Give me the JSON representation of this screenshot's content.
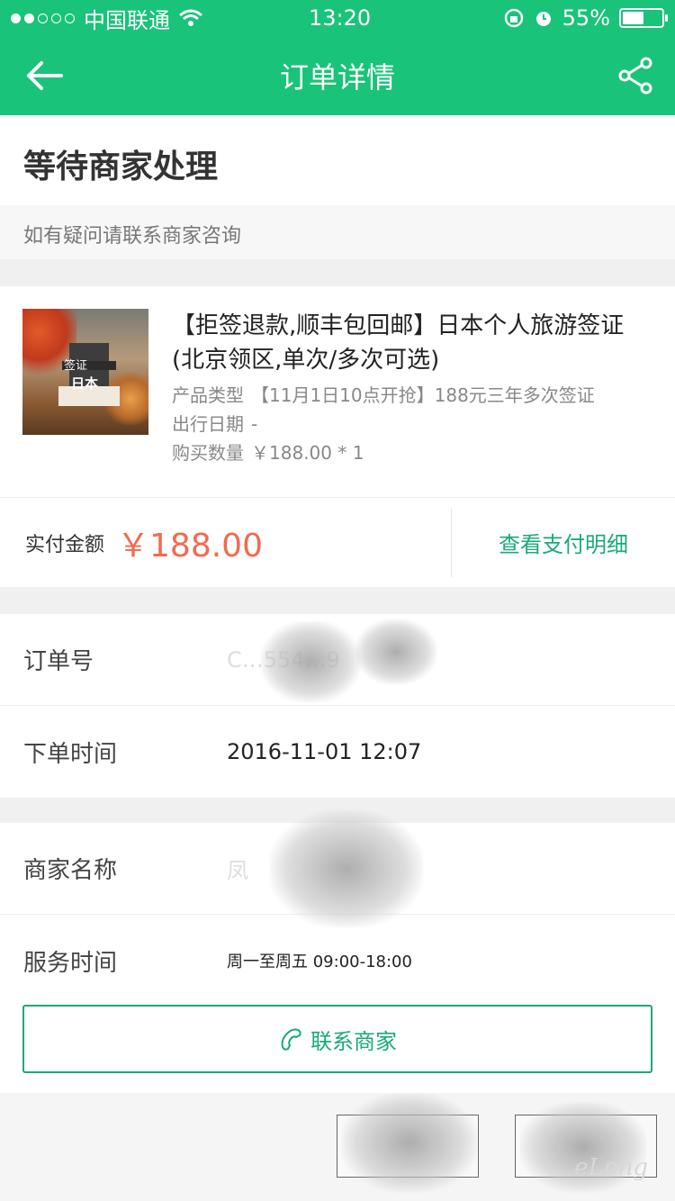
{
  "statusbar": {
    "carrier": "中国联通",
    "time": "13:20",
    "battery_text": "55%",
    "battery_level": 0.55
  },
  "navbar": {
    "title": "订单详情"
  },
  "order_status": {
    "headline": "等待商家处理",
    "hint": "如有疑问请联系商家咨询"
  },
  "product": {
    "thumb_caption_top": "签证",
    "thumb_caption_bottom": "日本",
    "title": "【拒签退款,顺丰包回邮】日本个人旅游签证(北京领区,单次/多次可选)",
    "type_label": "产品类型",
    "type_value": "【11月1日10点开抢】188元三年多次签证",
    "date_label": "出行日期",
    "date_value": "-",
    "qty_label": "购买数量",
    "qty_value": "￥188.00 * 1"
  },
  "payment": {
    "label": "实付金额",
    "amount": "￥188.00",
    "detail_link": "查看支付明细"
  },
  "order_info": {
    "order_no_label": "订单号",
    "order_no_value": "C…554…9",
    "time_label": "下单时间",
    "time_value": "2016-11-01 12:07"
  },
  "merchant": {
    "name_label": "商家名称",
    "name_value": "凤",
    "hours_label": "服务时间",
    "hours_value": "周一至周五 09:00-18:00",
    "contact_label": "联系商家"
  },
  "watermark": "eLong",
  "colors": {
    "brand": "#19c37a",
    "accent": "#19a97a",
    "price": "#f26a4e"
  }
}
